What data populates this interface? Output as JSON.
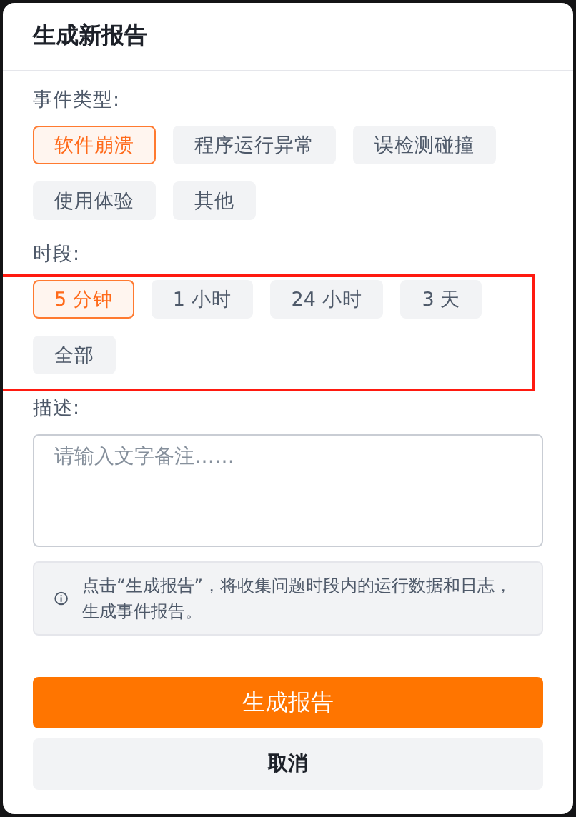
{
  "dialog": {
    "title": "生成新报告"
  },
  "event_type": {
    "label": "事件类型:",
    "options": [
      {
        "label": "软件崩溃",
        "selected": true
      },
      {
        "label": "程序运行异常",
        "selected": false
      },
      {
        "label": "误检测碰撞",
        "selected": false
      },
      {
        "label": "使用体验",
        "selected": false
      },
      {
        "label": "其他",
        "selected": false
      }
    ]
  },
  "period": {
    "label": "时段:",
    "highlighted": true,
    "options": [
      {
        "label": "5 分钟",
        "selected": true
      },
      {
        "label": "1 小时",
        "selected": false
      },
      {
        "label": "24 小时",
        "selected": false
      },
      {
        "label": "3 天",
        "selected": false
      },
      {
        "label": "全部",
        "selected": false
      }
    ]
  },
  "description": {
    "label": "描述:",
    "placeholder": "请输入文字备注……"
  },
  "info": {
    "text": "点击“生成报告”，将收集问题时段内的运行数据和日志，生成事件报告。"
  },
  "buttons": [
    {
      "kind": "primary",
      "label": "生成报告"
    },
    {
      "kind": "secondary",
      "label": "取消"
    }
  ]
}
